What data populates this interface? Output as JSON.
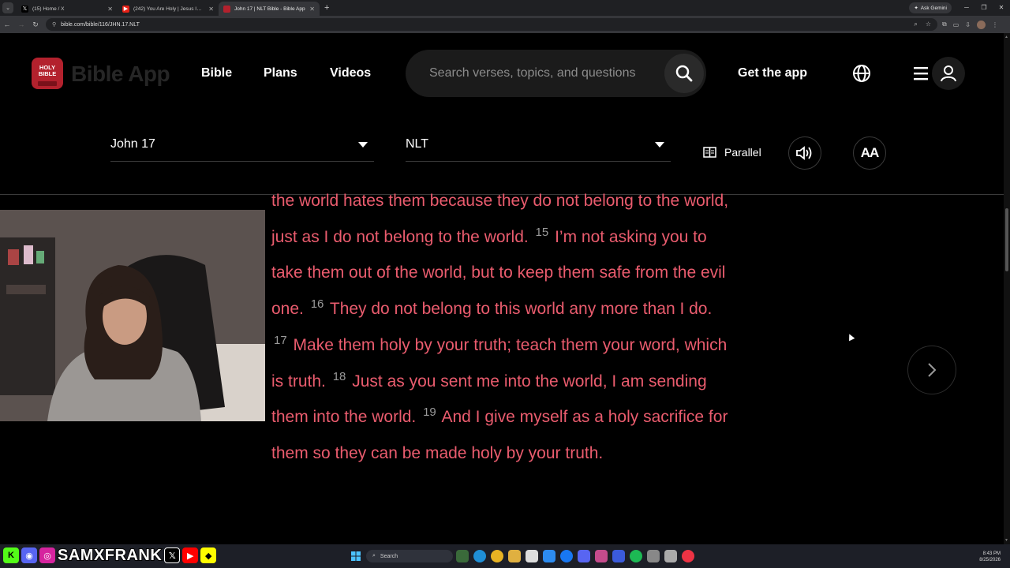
{
  "browser": {
    "tabs": [
      {
        "title": "(15) Home / X",
        "icon": "x-icon"
      },
      {
        "title": "(242) You Are Holy | Jesus Image",
        "icon": "youtube-icon"
      },
      {
        "title": "John 17 | NLT Bible - Bible App",
        "icon": "bible-app-icon",
        "active": true
      }
    ],
    "new_tab": "+",
    "ask_gemini": "Ask Gemini",
    "url": "bible.com/bible/116/JHN.17.NLT"
  },
  "header": {
    "logo_text": "HOLY BIBLE",
    "brand": "Bible App",
    "nav": [
      "Bible",
      "Plans",
      "Videos"
    ],
    "search_placeholder": "Search verses, topics, and questions",
    "get_app": "Get the app"
  },
  "reader": {
    "book_chapter": "John 17",
    "version": "NLT",
    "parallel_label": "Parallel",
    "font_button": "AA",
    "segments": [
      {
        "type": "text",
        "value": "the world hates them because they do not belong to the world, just as I do not belong to the world. "
      },
      {
        "type": "verse",
        "value": "15"
      },
      {
        "type": "text",
        "value": " I’m not asking you to take them out of the world, but to keep them safe from the evil one. "
      },
      {
        "type": "verse",
        "value": "16"
      },
      {
        "type": "text",
        "value": " They do not belong to this world any more than I do. "
      },
      {
        "type": "verse",
        "value": "17"
      },
      {
        "type": "text",
        "value": " Make them holy by your truth; teach them your word, which is truth. "
      },
      {
        "type": "verse",
        "value": "18"
      },
      {
        "type": "text",
        "value": " Just as you sent me into the world, I am sending them into the world. "
      },
      {
        "type": "verse",
        "value": "19"
      },
      {
        "type": "text",
        "value": " And I give myself as a holy sacrifice for them so they can be made holy by your truth."
      }
    ]
  },
  "overlay": {
    "name": "SAMXFRANK"
  },
  "taskbar": {
    "search": "Search",
    "time": "8:43 PM",
    "date": "8/25/2026"
  },
  "colors": {
    "verse_text": "#ea5c6e",
    "verse_number": "#9a9a9a",
    "logo": "#b3212d"
  }
}
